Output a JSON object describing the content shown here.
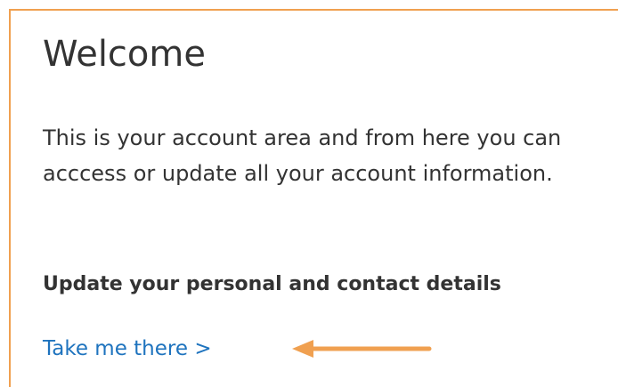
{
  "welcome": {
    "title": "Welcome",
    "intro": "This is your account area and from here you can acccess or update all your account information.",
    "section_heading": "Update your personal and contact details",
    "link_label": "Take me there >"
  },
  "colors": {
    "panel_border": "#F0A050",
    "arrow": "#F0A050",
    "link": "#1E73BE",
    "text": "#333333"
  },
  "icons": {
    "annotation": "left-arrow-icon"
  }
}
